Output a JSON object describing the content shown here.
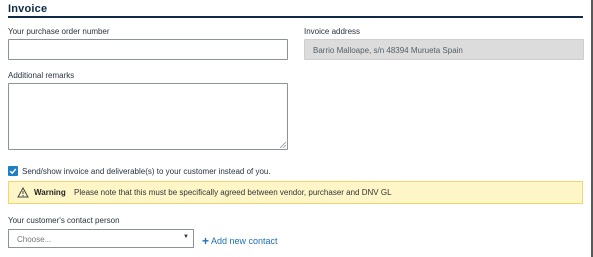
{
  "section": {
    "title": "Invoice"
  },
  "po_number": {
    "label": "Your purchase order number",
    "value": ""
  },
  "invoice_address": {
    "label": "Invoice address",
    "value": "Barrio Malloape, s/n 48394 Murueta Spain"
  },
  "remarks": {
    "label": "Additional remarks",
    "value": ""
  },
  "send_to_customer": {
    "checked": true,
    "label": "Send/show invoice and deliverable(s) to your customer instead of you."
  },
  "warning": {
    "title": "Warning",
    "message": "Please note that this must be specifically agreed between vendor, purchaser and DNV GL",
    "icon": "warning-triangle-icon"
  },
  "contact": {
    "label": "Your customer's contact person",
    "placeholder": "Choose...",
    "add_label": "Add new contact"
  },
  "colors": {
    "accent": "#1f7fc4",
    "heading": "#0f2b46",
    "warning_bg": "#fff6c8",
    "warning_border": "#f2d66b"
  }
}
